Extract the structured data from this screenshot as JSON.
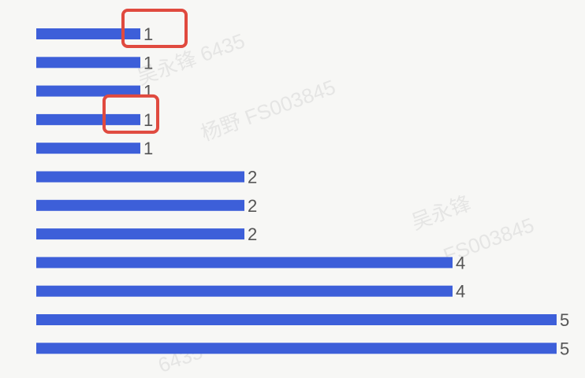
{
  "chart_data": {
    "type": "bar",
    "orientation": "horizontal",
    "categories": [],
    "values": [
      1,
      1,
      1,
      1,
      1,
      2,
      2,
      2,
      4,
      4,
      5,
      5
    ],
    "xlim": [
      0,
      5
    ],
    "grid": false,
    "legend": "none",
    "bar_color": "#3d5fd9",
    "label_color": "#555555",
    "highlight_color": "#e04a3f",
    "highlighted_bars": [
      0,
      3
    ]
  },
  "watermarks": [
    "吴永锋 6435",
    "杨野 FS003845",
    "吴永锋",
    "FS003845",
    "6435"
  ]
}
